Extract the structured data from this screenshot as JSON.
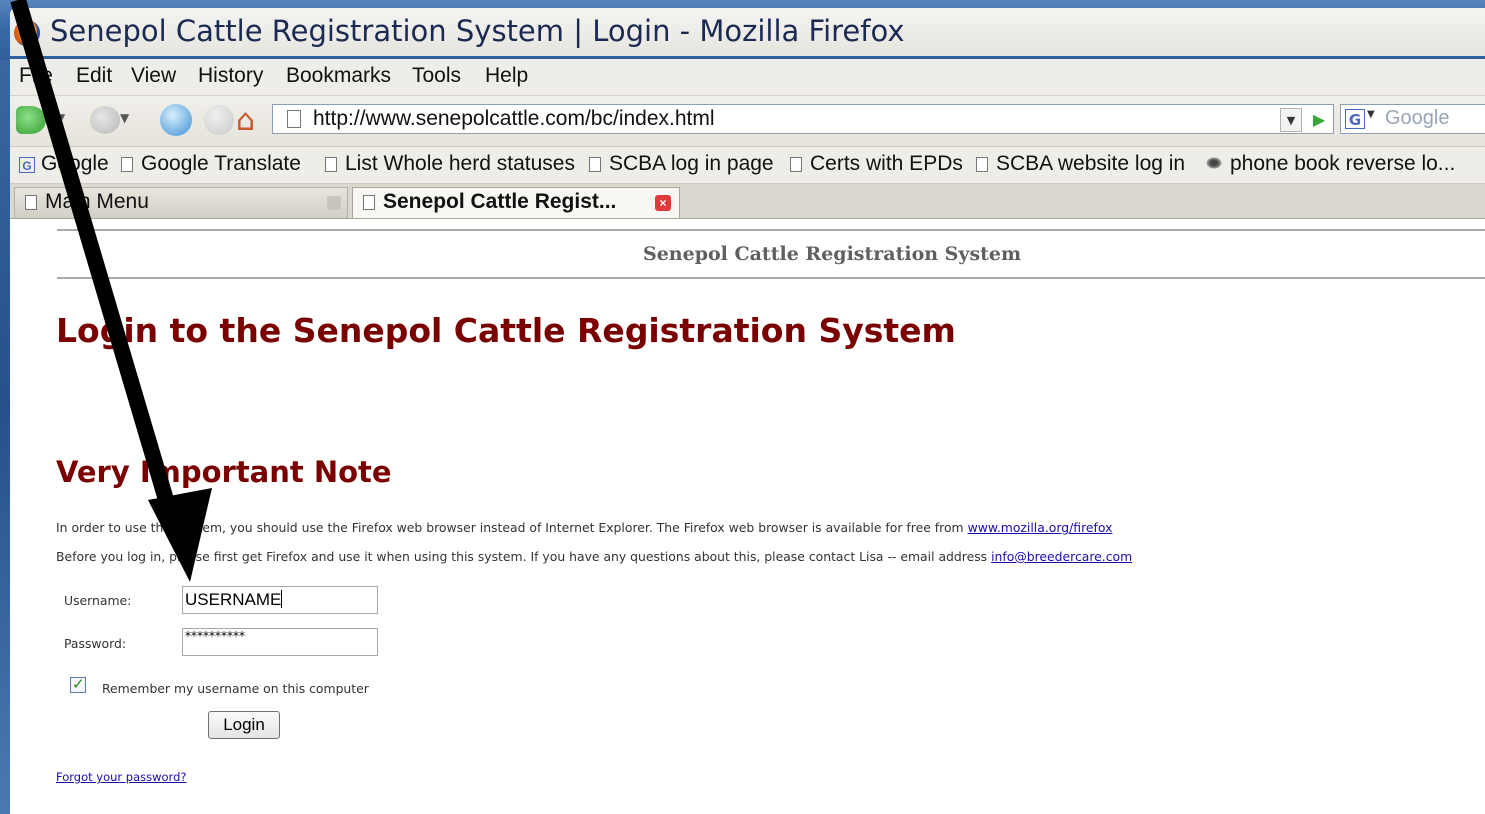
{
  "window": {
    "title": "Senepol Cattle Registration System | Login - Mozilla Firefox"
  },
  "menu": [
    "File",
    "Edit",
    "View",
    "History",
    "Bookmarks",
    "Tools",
    "Help"
  ],
  "nav": {
    "url": "http://www.senepolcattle.com/bc/index.html",
    "search_placeholder": "Google",
    "search_engine_letter": "G"
  },
  "bookmarks": [
    {
      "label": "Google",
      "icon": "google-icon"
    },
    {
      "label": "Google Translate",
      "icon": "page-icon"
    },
    {
      "label": "List Whole herd statuses",
      "icon": "page-icon"
    },
    {
      "label": "SCBA log in page",
      "icon": "page-icon"
    },
    {
      "label": "Certs with EPDs",
      "icon": "page-icon"
    },
    {
      "label": "SCBA website log in",
      "icon": "page-icon"
    },
    {
      "label": "phone book reverse lo...",
      "icon": "globe-icon"
    }
  ],
  "tabs": [
    {
      "label": "Main Menu",
      "active": false
    },
    {
      "label": "Senepol Cattle Regist...",
      "active": true
    }
  ],
  "page": {
    "site_header": "Senepol Cattle Registration System",
    "heading": "Login to the Senepol Cattle Registration System",
    "note_heading": "Very Important Note",
    "note_line1_text": "In order to use this system, you should use the Firefox web browser instead of Internet Explorer. The Firefox web browser is available for free from ",
    "note_line1_link": "www.mozilla.org/firefox",
    "note_line2_text": "Before you log in, please first get Firefox and use it when using this system. If you have any questions about this, please contact Lisa -- email address ",
    "note_line2_link": "info@breedercare.com",
    "username_label": "Username:",
    "username_value": "USERNAME",
    "password_label": "Password:",
    "password_value": "**********",
    "remember_label": "Remember my username on this computer",
    "remember_checked": true,
    "login_button": "Login",
    "forgot_link": "Forgot your password?"
  },
  "colors": {
    "heading": "#7a0000",
    "link": "#1a0dab",
    "desktop": "#2f5f9d"
  }
}
